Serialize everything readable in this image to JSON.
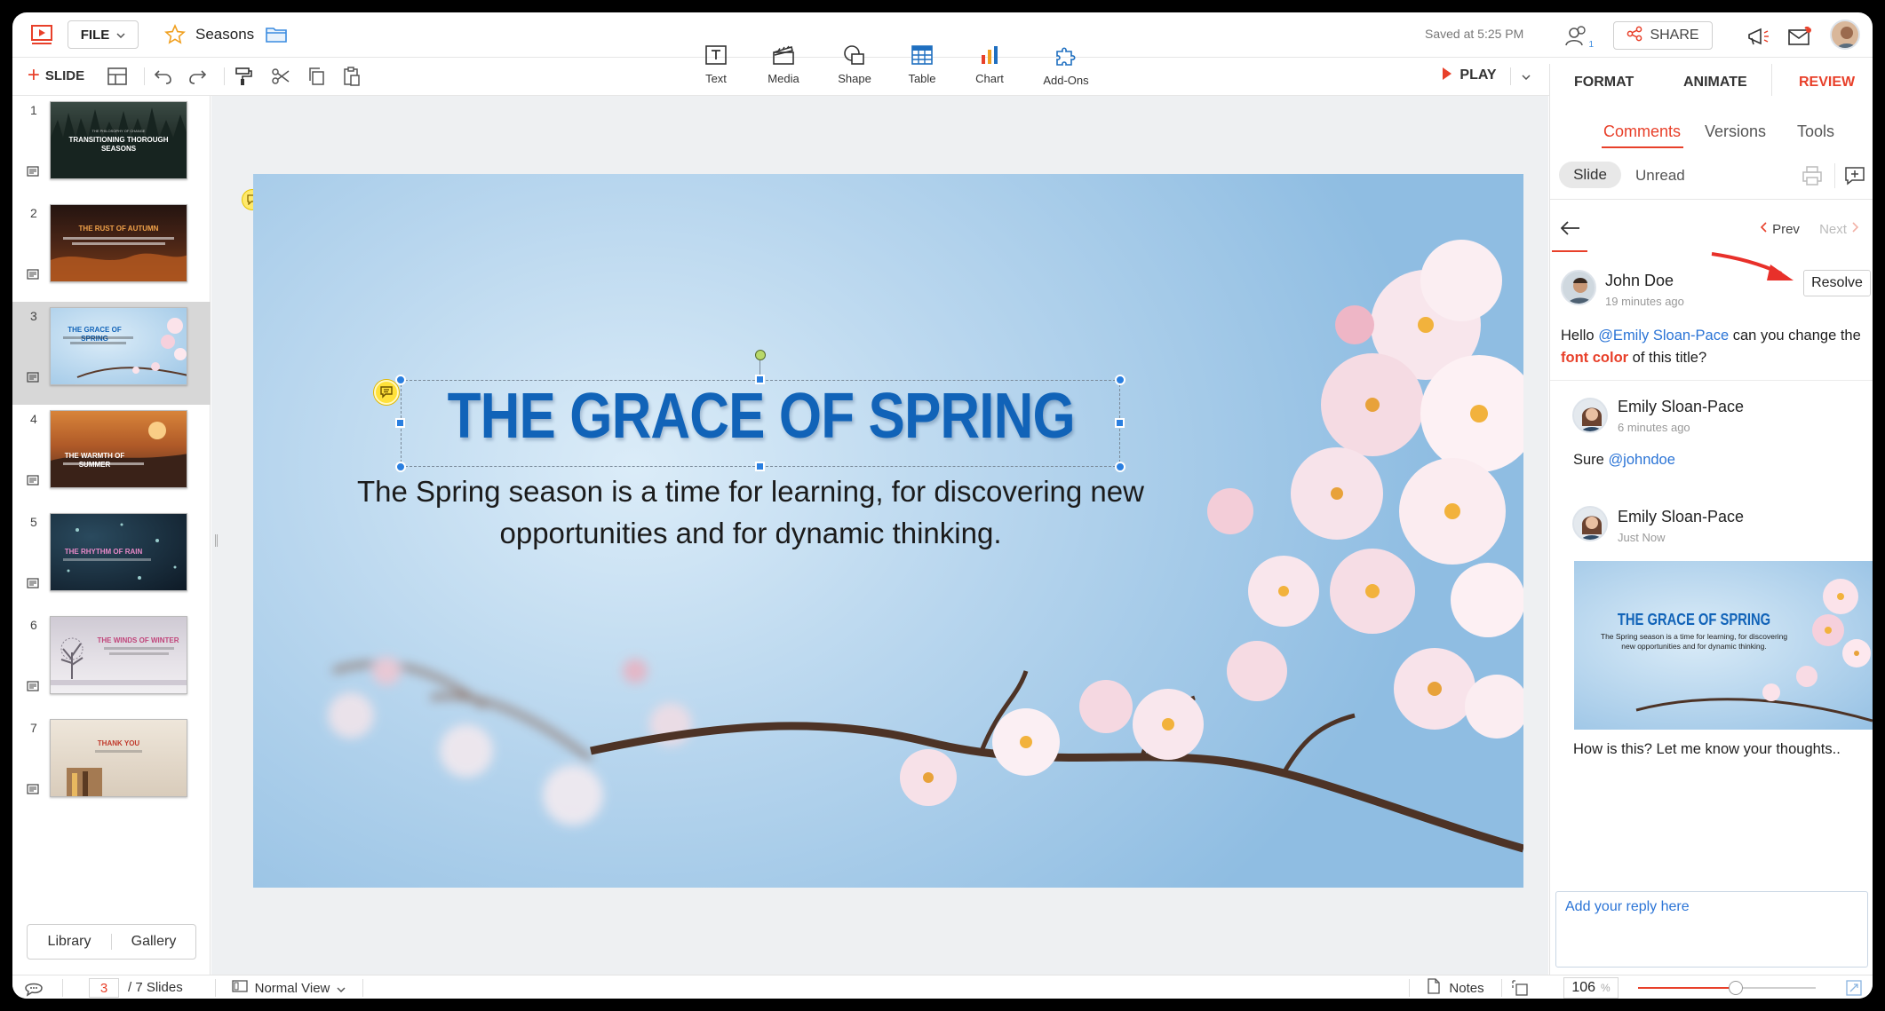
{
  "app": {
    "file_menu": "FILE",
    "doc_name": "Seasons",
    "saved_status": "Saved at 5:25 PM",
    "share_label": "SHARE",
    "collab_badge": "1"
  },
  "toolbar": {
    "slide_label": "SLIDE",
    "play_label": "PLAY"
  },
  "insert": [
    {
      "label": "Text",
      "icon": "text-box-icon"
    },
    {
      "label": "Media",
      "icon": "media-clapper-icon"
    },
    {
      "label": "Shape",
      "icon": "shape-icon"
    },
    {
      "label": "Table",
      "icon": "table-icon"
    },
    {
      "label": "Chart",
      "icon": "bar-chart-icon"
    },
    {
      "label": "Add-Ons",
      "icon": "puzzle-icon"
    }
  ],
  "panel_tabs": [
    "FORMAT",
    "ANIMATE",
    "REVIEW"
  ],
  "review": {
    "tabs": [
      "Comments",
      "Versions",
      "Tools"
    ],
    "filters": [
      "Slide",
      "Unread"
    ],
    "prev": "Prev",
    "next": "Next",
    "resolve": "Resolve",
    "reply_placeholder": "Add your reply here"
  },
  "comments": [
    {
      "author": "John Doe",
      "time": "19 minutes ago",
      "text_parts": [
        "Hello ",
        "@Emily Sloan-Pace",
        " can you change the ",
        "font color",
        " of this title?"
      ]
    },
    {
      "author": "Emily Sloan-Pace",
      "time": "6 minutes ago",
      "text_parts": [
        "Sure ",
        "@johndoe"
      ]
    },
    {
      "author": "Emily Sloan-Pace",
      "time": "Just Now",
      "attachment": {
        "title": "THE GRACE OF SPRING",
        "body": "The Spring season is a time for learning, for discovering new opportunities and for dynamic thinking."
      },
      "text": "How is this? Let me know your thoughts.."
    }
  ],
  "slide": {
    "title": "THE GRACE OF SPRING",
    "body": "The Spring season is a time for learning, for discovering new opportunities and for dynamic thinking."
  },
  "thumbnails": [
    {
      "num": "1",
      "title": "TRANSITIONING THOROUGH SEASONS",
      "kicker": "THE PHILOSOPHY OF CHANGE",
      "bg": "#24302c",
      "fg": "#ffffff"
    },
    {
      "num": "2",
      "title": "THE RUST OF AUTUMN",
      "bg": "#3a1d12",
      "fg": "#f0a24a"
    },
    {
      "num": "3",
      "title": "THE GRACE OF SPRING",
      "bg": "#b7d6ee",
      "fg": "#1163b8"
    },
    {
      "num": "4",
      "title": "THE WARMTH OF SUMMER",
      "bg": "#9a4a22",
      "fg": "#ffffff"
    },
    {
      "num": "5",
      "title": "THE RHYTHM OF RAIN",
      "bg": "#16283a",
      "fg": "#e889c8"
    },
    {
      "num": "6",
      "title": "THE WINDS OF WINTER",
      "bg": "#d9d6dc",
      "fg": "#c0457a"
    },
    {
      "num": "7",
      "title": "THANK YOU",
      "bg": "#e7ddd0",
      "fg": "#c0392b"
    }
  ],
  "sidebar": {
    "library": "Library",
    "gallery": "Gallery"
  },
  "status": {
    "current_slide": "3",
    "total": "/ 7 Slides",
    "view": "Normal View",
    "notes": "Notes",
    "zoom": "106",
    "zoom_unit": "%",
    "zoom_fraction": 0.55
  },
  "colors": {
    "accent": "#e8402a",
    "selection": "#2a7fe0",
    "slide_title": "#1163b8"
  }
}
